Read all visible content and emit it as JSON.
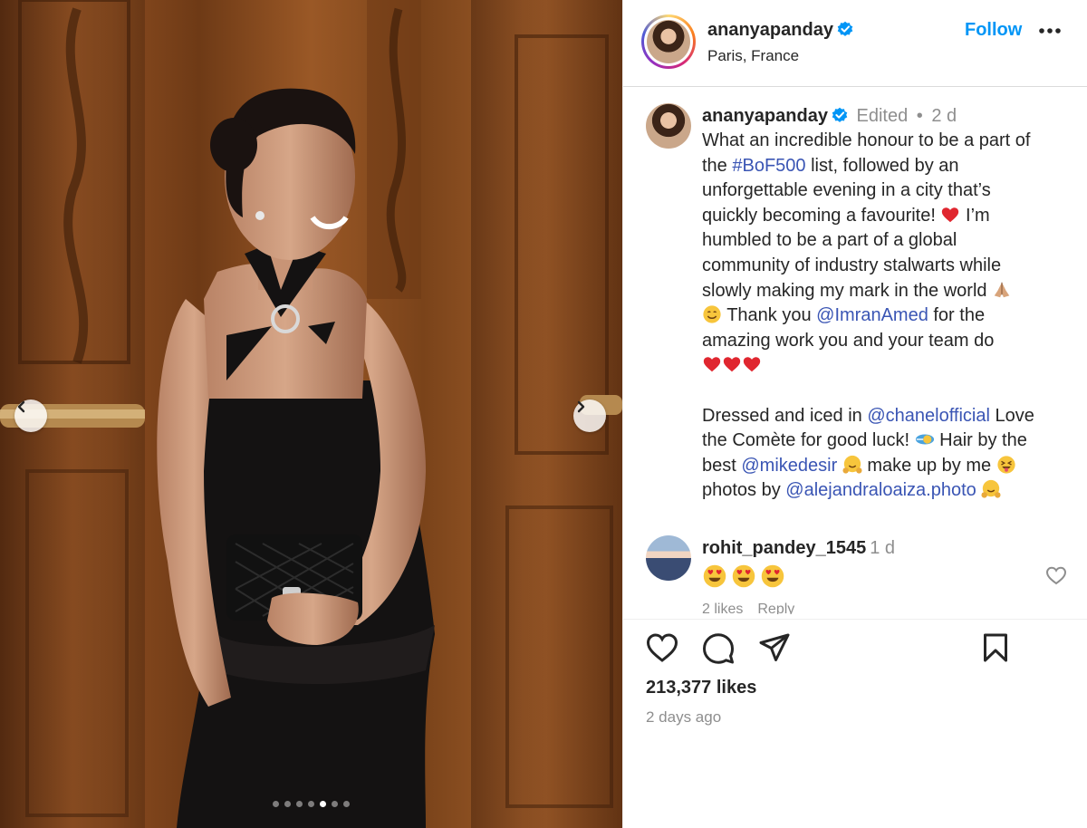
{
  "post": {
    "username": "ananyapanday",
    "location": "Paris, France",
    "follow_label": "Follow",
    "verified": true
  },
  "caption": {
    "username": "ananyapanday",
    "edited": "Edited",
    "separator": "•",
    "time": "2 d",
    "line1": "What an incredible honour to be a part of",
    "line2_pre": "the ",
    "line2_tag": "#BoF500",
    "line2_post": " list, followed by an",
    "line3": "unforgettable evening in a city that’s",
    "line4": "quickly becoming a favourite!",
    "line4_post": " I’m",
    "line5": "humbled to be a part of a global",
    "line6": "community of industry stalwarts while",
    "line7": "slowly making my mark in the world",
    "line8_pre": " Thank you ",
    "line8_mention": "@ImranAmed",
    "line8_post": " for the",
    "line9": "amazing work you and your team do",
    "line11_pre": "Dressed and iced in ",
    "line11_mention": "@chanelofficial",
    "line11_post": " Love",
    "line12_pre": "the Comète for good luck!",
    "line12_post": " Hair by the",
    "line13_pre": "best ",
    "line13_mention": "@mikedesir",
    "line13_post": " make up by me",
    "line14_pre": "photos by ",
    "line14_mention": "@alejandraloaiza.photo"
  },
  "comment": {
    "username": "rohit_pandey_1545",
    "time": "1 d",
    "likes": "2 likes",
    "reply": "Reply"
  },
  "stats": {
    "likes": "213,377 likes",
    "posted": "2 days ago"
  },
  "carousel": {
    "slide_count": 7,
    "active_index": 4
  },
  "colors": {
    "accent": "#0095f6",
    "link": "#3a55b4",
    "muted": "#8e8e8e",
    "verified": "#0095f6"
  },
  "icons": {
    "prev": "chevron-left-icon",
    "next": "chevron-right-icon",
    "more": "more-horizontal-icon",
    "like": "heart-icon",
    "comment": "comment-icon",
    "share": "send-icon",
    "save": "bookmark-icon"
  }
}
